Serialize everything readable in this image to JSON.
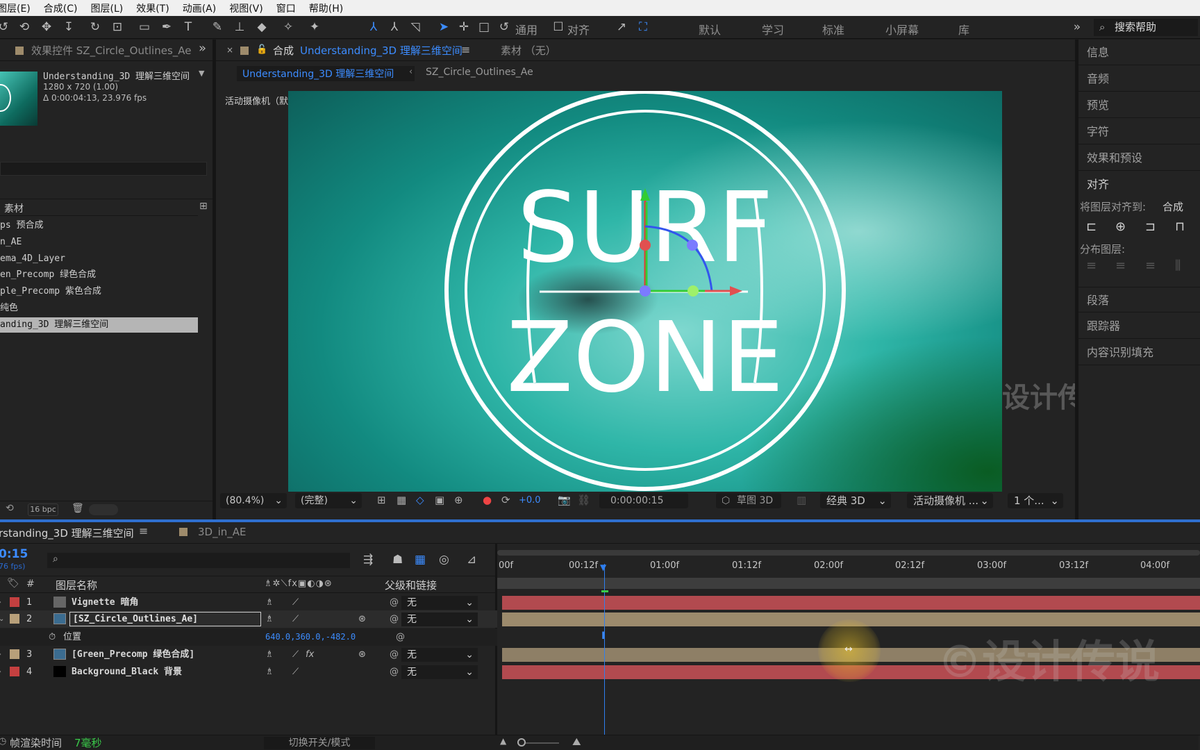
{
  "menu": [
    "图层(E)",
    "合成(C)",
    "图层(L)",
    "效果(T)",
    "动画(A)",
    "视图(V)",
    "窗口",
    "帮助(H)"
  ],
  "toolbar": {
    "general_label": "通用",
    "align_label": "对齐",
    "workspaces": [
      "默认",
      "学习",
      "标准",
      "小屏幕",
      "库"
    ],
    "search_help": "搜索帮助"
  },
  "effects_panel": {
    "title": "效果控件 SZ_Circle_Outlines_Ae"
  },
  "project": {
    "comp_name": "Understanding_3D 理解三维空间",
    "comp_size": "1280 x 720 (1.00)",
    "comp_duration": "Δ 0:00:04:13, 23.976 fps",
    "col_header": "素材",
    "items": [
      "ps 预合成",
      "n_AE",
      "ema_4D_Layer",
      "en_Precomp 绿色合成",
      "ple_Precomp 紫色合成",
      "纯色",
      "anding_3D 理解三维空间"
    ],
    "bpc": "16 bpc"
  },
  "comp_panel": {
    "tab_prefix": "合成",
    "tab_name": "Understanding_3D 理解三维空间",
    "footage_tab": "素材 （无）",
    "breadcrumb_1": "Understanding_3D 理解三维空间",
    "breadcrumb_2": "SZ_Circle_Outlines_Ae",
    "camera_label": "活动摄像机（默认）",
    "logo_line1": "SURF",
    "logo_line2": "ZONE",
    "watermark_1": "设计传说",
    "watermark_2": "©设计传说",
    "zoom": "(80.4%)",
    "resolution": "(完整)",
    "exposure": "+0.0",
    "timecode": "0:00:00:15",
    "renderer_label": "草图 3D",
    "renderer": "经典 3D",
    "camera_view": "活动摄像机 ...",
    "views": "1 个..."
  },
  "right_panel": {
    "items": [
      "信息",
      "音频",
      "预览",
      "字符",
      "效果和预设",
      "对齐"
    ],
    "align_to_label": "将图层对齐到:",
    "align_to_value": "合成",
    "distribute_label": "分布图层:",
    "items_after": [
      "段落",
      "跟踪器",
      "内容识别填充"
    ]
  },
  "timeline": {
    "tab_name": "rstanding_3D 理解三维空间",
    "other_tab": "3D_in_AE",
    "current_time": "0:15",
    "fps_hint": "76 fps)",
    "col_hash": "#",
    "col_layer_name": "图层名称",
    "col_parent": "父级和链接",
    "ruler": [
      "00f",
      "00:12f",
      "01:00f",
      "01:12f",
      "02:00f",
      "02:12f",
      "03:00f",
      "03:12f",
      "04:00f"
    ],
    "layers": [
      {
        "num": "1",
        "name": "Vignette 暗角",
        "parent": "无",
        "color": "#c44040"
      },
      {
        "num": "2",
        "name": "[SZ_Circle_Outlines_Ae]",
        "parent": "无",
        "color": "#b8a07a"
      },
      {
        "num": "3",
        "name": "[Green_Precomp 绿色合成]",
        "parent": "无",
        "color": "#b8a07a"
      },
      {
        "num": "4",
        "name": "Background_Black 背景",
        "parent": "无",
        "color": "#c44040"
      }
    ],
    "position_label": "位置",
    "position_value": "640.0,360.0,-482.0",
    "render_time_label": "帧渲染时间",
    "render_time_value": "7毫秒",
    "toggle_label": "切换开关/模式"
  },
  "colors": {
    "accent": "#3c8cff",
    "label_red": "#c44040",
    "label_tan": "#b8a07a",
    "bar_red": "#b24a4f",
    "bar_tan": "#9c8a6c"
  }
}
